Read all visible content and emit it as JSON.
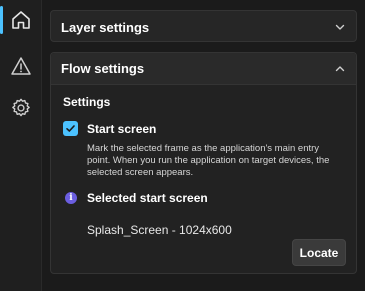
{
  "rail": {
    "items": [
      {
        "icon": "home-icon",
        "active": true
      },
      {
        "icon": "warning-icon",
        "active": false
      },
      {
        "icon": "gear-icon",
        "active": false
      }
    ],
    "accent": "#4cc2ff"
  },
  "layer_settings": {
    "title": "Layer settings",
    "expanded": false
  },
  "flow_settings": {
    "title": "Flow settings",
    "expanded": true,
    "section_title": "Settings",
    "start_screen": {
      "label": "Start screen",
      "checked": true,
      "description": "Mark the selected frame as the application's main entry point. When you run the application on target devices, the selected screen appears."
    },
    "selected_start_screen": {
      "label": "Selected start screen",
      "info_icon": "i",
      "value": "Splash_Screen - 1024x600"
    },
    "locate_button": "Locate"
  }
}
